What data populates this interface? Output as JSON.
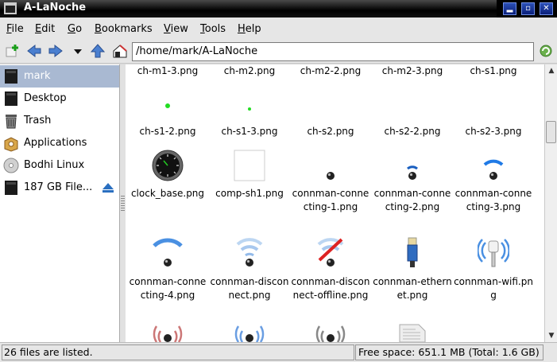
{
  "window": {
    "title": "A-LaNoche"
  },
  "menu": [
    "File",
    "Edit",
    "Go",
    "Bookmarks",
    "View",
    "Tools",
    "Help"
  ],
  "menu_mnemonics": [
    "F",
    "E",
    "G",
    "B",
    "V",
    "T",
    "H"
  ],
  "toolbar": {
    "icons": [
      "new-tab-icon",
      "back-icon",
      "forward-icon",
      "history-dropdown-icon",
      "up-icon",
      "home-icon",
      "reload-icon"
    ],
    "path": "/home/mark/A-LaNoche"
  },
  "sidebar": {
    "items": [
      {
        "label": "mark",
        "icon": "home-folder-icon",
        "selected": true
      },
      {
        "label": "Desktop",
        "icon": "desktop-icon"
      },
      {
        "label": "Trash",
        "icon": "trash-icon"
      },
      {
        "label": "Applications",
        "icon": "applications-icon"
      },
      {
        "label": "Bodhi Linux",
        "icon": "optical-disc-icon"
      },
      {
        "label": "187 GB File...",
        "icon": "drive-icon",
        "eject": true
      }
    ]
  },
  "files": [
    {
      "name": "ch-m1-3.png"
    },
    {
      "name": "ch-m2.png"
    },
    {
      "name": "ch-m2-2.png"
    },
    {
      "name": "ch-m2-3.png"
    },
    {
      "name": "ch-s1.png"
    },
    {
      "name": "ch-s1-2.png",
      "icon": "green-dot-icon"
    },
    {
      "name": "ch-s1-3.png",
      "icon": "green-dot-icon"
    },
    {
      "name": "ch-s2.png"
    },
    {
      "name": "ch-s2-2.png"
    },
    {
      "name": "ch-s2-3.png"
    },
    {
      "name": "clock_base.png",
      "icon": "clock-icon"
    },
    {
      "name": "comp-sh1.png",
      "icon": "blank-image-icon"
    },
    {
      "name": "connman-connecting-1.png",
      "icon": "ball-icon"
    },
    {
      "name": "connman-connecting-2.png",
      "icon": "wifi-signal-icon"
    },
    {
      "name": "connman-connecting-3.png",
      "icon": "wifi-signal-icon"
    },
    {
      "name": "connman-connecting-4.png",
      "icon": "wifi-signal-icon"
    },
    {
      "name": "connman-disconnect.png",
      "icon": "wifi-faded-icon"
    },
    {
      "name": "connman-disconnect-offline.png",
      "icon": "wifi-offline-icon"
    },
    {
      "name": "connman-ethernet.png",
      "icon": "ethernet-plug-icon"
    },
    {
      "name": "connman-wifi.png",
      "icon": "wifi-broadcast-icon"
    }
  ],
  "status": {
    "left": "26 files are listed.",
    "right": "Free space: 651.1 MB (Total: 1.6 GB)"
  },
  "colors": {
    "selection": "#a9b9d2",
    "accent_blue": "#2a72d0",
    "green_dot": "#22dd22"
  }
}
